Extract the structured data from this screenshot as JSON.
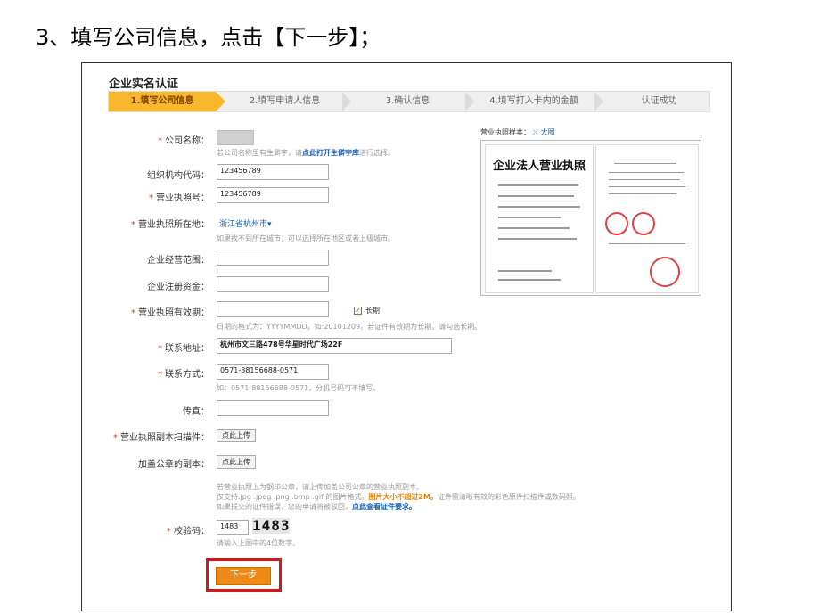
{
  "caption": "3、填写公司信息，点击【下一步】；",
  "form": {
    "title": "企业实名认证",
    "steps": [
      "1.填写公司信息",
      "2.填写申请人信息",
      "3.确认信息",
      "4.填写打入卡内的金额",
      "认证成功"
    ],
    "fields": {
      "company_name": {
        "label": "公司名称：",
        "hint_prefix": "若公司名称里有生僻字，请",
        "hint_link": "点此打开生僻字库",
        "hint_suffix": "进行选择。"
      },
      "org_code": {
        "label": "组织机构代码：",
        "value": "123456789"
      },
      "license_no": {
        "label": "营业执照号：",
        "value": "123456789"
      },
      "license_location": {
        "label": "营业执照所在地：",
        "value": "浙江省杭州市▾",
        "hint": "如果找不到所在城市，可以选择所在地区或者上级城市。"
      },
      "business_scope": {
        "label": "企业经营范围："
      },
      "registered_capital": {
        "label": "企业注册资金："
      },
      "license_validity": {
        "label": "营业执照有效期：",
        "checkbox_label": "长期",
        "hint": "日期的格式为：YYYYMMDD，如:20101209。若证件有效期为长期，请勾选长期。"
      },
      "address": {
        "label": "联系地址：",
        "value": "杭州市文三路478号华星时代广场22F"
      },
      "phone": {
        "label": "联系方式：",
        "value": "0571-88156688-0571",
        "hint": "如：0571-88156688-0571，分机号码可不填写。"
      },
      "fax": {
        "label": "传真："
      },
      "license_scan": {
        "label": "营业执照副本扫描件：",
        "button": "点此上传"
      },
      "sealed_copy": {
        "label": "加盖公章的副本：",
        "button": "点此上传"
      },
      "upload_notes": {
        "line1": "若营业执照上为钢印公章，请上传加盖公司公章的营业执照副本。",
        "line2_prefix": "仅支持.jpg .jpeg .png .bmp .gif 的图片格式。",
        "line2_warn": "图片大小不超过2M。",
        "line2_suffix": "证件需清晰有效的彩色原件扫描件或数码照。",
        "line3_prefix": "如果提交的证件错误，您的申请将被驳回，",
        "line3_link": "点此查看证件要求。"
      },
      "captcha": {
        "label": "校验码：",
        "value": "1483",
        "image_text": "1483",
        "hint": "请输入上图中的4位数字。"
      }
    },
    "next_button": "下一步",
    "sample": {
      "label": "营业执照样本：",
      "zoom": "⤫ 大图",
      "doc_title": "企业法人营业执照"
    }
  }
}
